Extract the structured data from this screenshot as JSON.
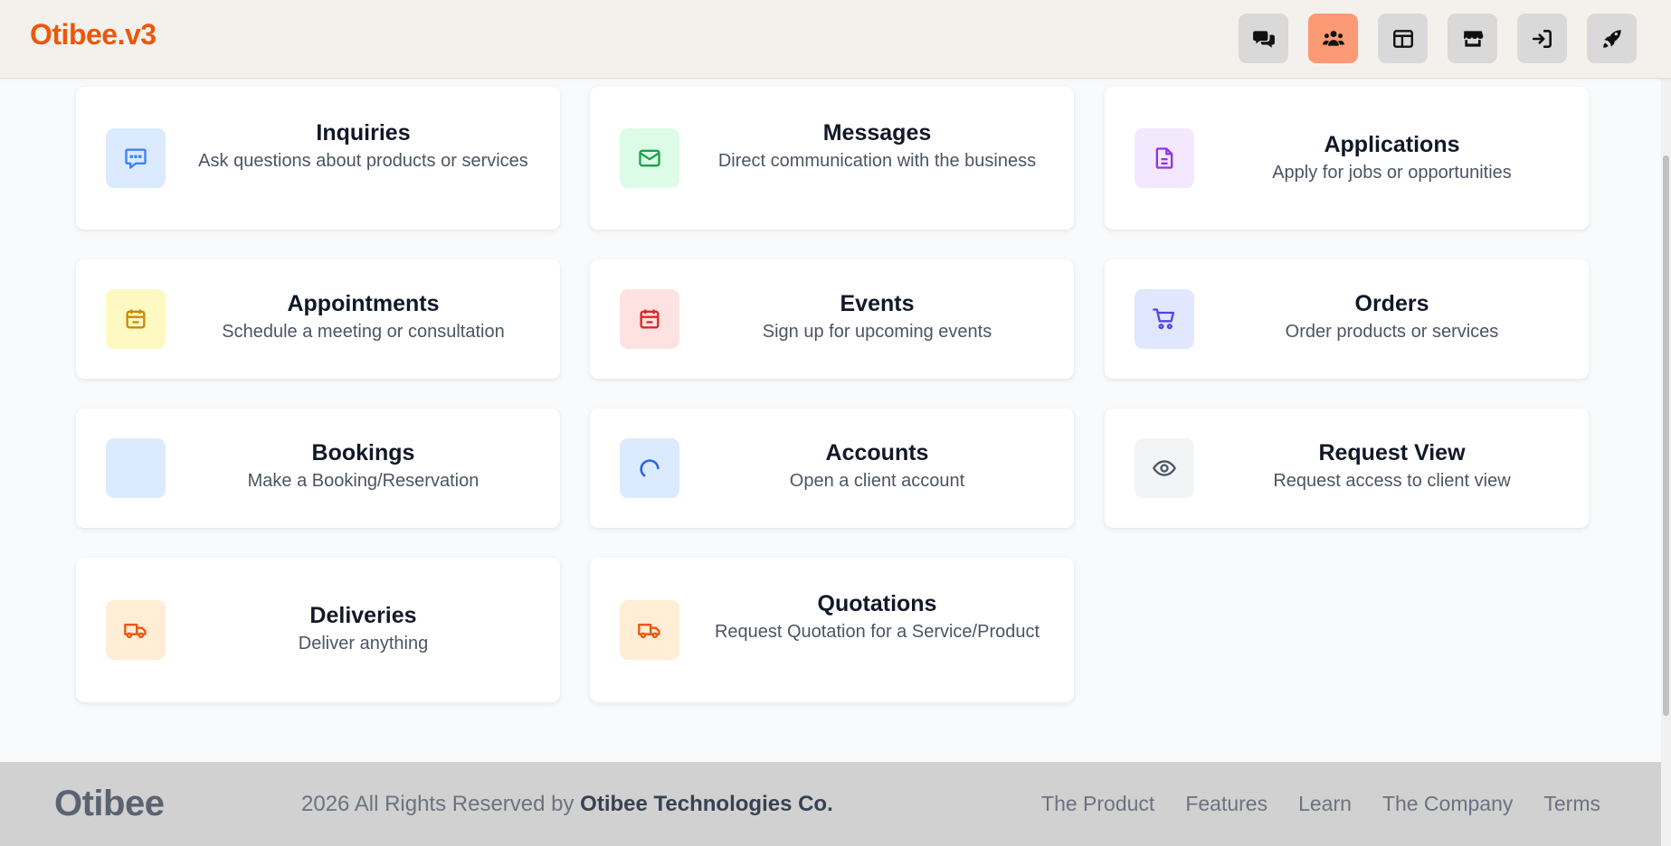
{
  "header": {
    "brand": "Otibee.v3",
    "nav": [
      {
        "icon": "chat-bubbles-icon",
        "active": false
      },
      {
        "icon": "users-icon",
        "active": true
      },
      {
        "icon": "layout-icon",
        "active": false
      },
      {
        "icon": "store-icon",
        "active": false
      },
      {
        "icon": "sign-in-icon",
        "active": false
      },
      {
        "icon": "rocket-icon",
        "active": false
      }
    ]
  },
  "cards": [
    {
      "title": "Inquiries",
      "desc": "Ask questions about products or services",
      "icon": "chat-icon",
      "color": "#3b82f6",
      "bg": "#dbeafe"
    },
    {
      "title": "Messages",
      "desc": "Direct communication with the business",
      "icon": "mail-icon",
      "color": "#16a34a",
      "bg": "#dcfce7"
    },
    {
      "title": "Applications",
      "desc": "Apply for jobs or opportunities",
      "icon": "document-icon",
      "color": "#9333ea",
      "bg": "#f3e8ff"
    },
    {
      "title": "Appointments",
      "desc": "Schedule a meeting or consultation",
      "icon": "calendar-icon",
      "color": "#ca8a04",
      "bg": "#fef9c3"
    },
    {
      "title": "Events",
      "desc": "Sign up for upcoming events",
      "icon": "calendar-icon",
      "color": "#dc2626",
      "bg": "#fee2e2"
    },
    {
      "title": "Orders",
      "desc": "Order products or services",
      "icon": "cart-icon",
      "color": "#4f46e5",
      "bg": "#e0e7ff"
    },
    {
      "title": "Bookings",
      "desc": "Make a Booking/Reservation",
      "icon": "blank-icon",
      "color": "#3b82f6",
      "bg": "#dbeafe"
    },
    {
      "title": "Accounts",
      "desc": "Open a client account",
      "icon": "spinner-icon",
      "color": "#2563eb",
      "bg": "#dbeafe"
    },
    {
      "title": "Request View",
      "desc": "Request access to client view",
      "icon": "eye-icon",
      "color": "#4b5563",
      "bg": "#f3f4f6"
    },
    {
      "title": "Deliveries",
      "desc": "Deliver anything",
      "icon": "truck-icon",
      "color": "#ea580c",
      "bg": "#ffedd5"
    },
    {
      "title": "Quotations",
      "desc": "Request Quotation for a Service/Product",
      "icon": "truck-icon",
      "color": "#ea580c",
      "bg": "#ffedd5"
    }
  ],
  "footer": {
    "brand": "Otibee",
    "copyright_prefix": "2026 All Rights Reserved by",
    "company": "Otibee Technologies Co.",
    "links": [
      "The Product",
      "Features",
      "Learn",
      "The Company",
      "Terms"
    ]
  }
}
